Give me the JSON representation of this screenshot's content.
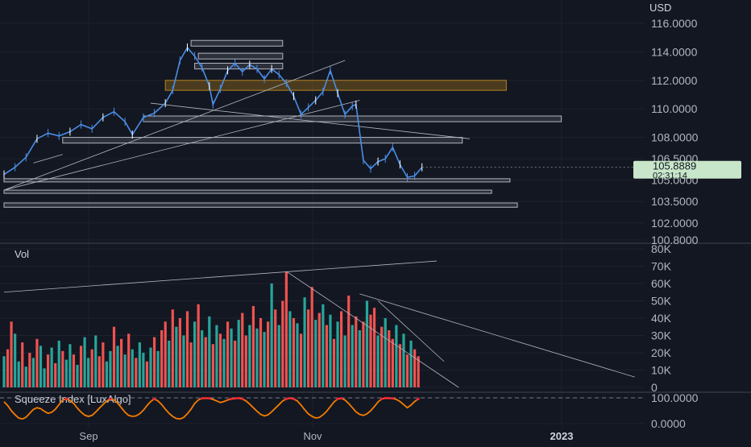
{
  "chart_data": [
    {
      "type": "candlestick",
      "name": "price",
      "currency": "USD",
      "y_ticks": [
        "116.0000",
        "114.0000",
        "112.0000",
        "110.0000",
        "108.0000",
        "106.5000",
        "105.0000",
        "103.5000",
        "102.0000",
        "100.8000"
      ],
      "last_price": "105.8889",
      "countdown": "02:31:14",
      "price_line": [
        {
          "t": 0,
          "v": 105.4
        },
        {
          "t": 3,
          "v": 105.9
        },
        {
          "t": 6,
          "v": 106.6
        },
        {
          "t": 9,
          "v": 107.9
        },
        {
          "t": 12,
          "v": 108.3
        },
        {
          "t": 15,
          "v": 108.1
        },
        {
          "t": 18,
          "v": 108.4
        },
        {
          "t": 21,
          "v": 108.9
        },
        {
          "t": 24,
          "v": 108.6
        },
        {
          "t": 27,
          "v": 109.4
        },
        {
          "t": 30,
          "v": 109.8
        },
        {
          "t": 33,
          "v": 109.1
        },
        {
          "t": 35,
          "v": 108.2
        },
        {
          "t": 38,
          "v": 109.4
        },
        {
          "t": 41,
          "v": 109.7
        },
        {
          "t": 44,
          "v": 110.4
        },
        {
          "t": 46,
          "v": 111.3
        },
        {
          "t": 48,
          "v": 113.4
        },
        {
          "t": 50,
          "v": 114.3
        },
        {
          "t": 52,
          "v": 113.7
        },
        {
          "t": 54,
          "v": 112.9
        },
        {
          "t": 56,
          "v": 111.6
        },
        {
          "t": 57,
          "v": 110.3
        },
        {
          "t": 59,
          "v": 111.4
        },
        {
          "t": 61,
          "v": 112.7
        },
        {
          "t": 63,
          "v": 113.2
        },
        {
          "t": 65,
          "v": 112.6
        },
        {
          "t": 67,
          "v": 113.1
        },
        {
          "t": 69,
          "v": 112.8
        },
        {
          "t": 71,
          "v": 112.1
        },
        {
          "t": 73,
          "v": 112.8
        },
        {
          "t": 75,
          "v": 112.4
        },
        {
          "t": 77,
          "v": 111.8
        },
        {
          "t": 79,
          "v": 110.9
        },
        {
          "t": 81,
          "v": 109.6
        },
        {
          "t": 83,
          "v": 110.1
        },
        {
          "t": 85,
          "v": 110.6
        },
        {
          "t": 87,
          "v": 111.2
        },
        {
          "t": 89,
          "v": 112.7
        },
        {
          "t": 91,
          "v": 111.1
        },
        {
          "t": 93,
          "v": 109.6
        },
        {
          "t": 95,
          "v": 110.2
        },
        {
          "t": 96,
          "v": 110.3
        },
        {
          "t": 98,
          "v": 106.4
        },
        {
          "t": 100,
          "v": 105.8
        },
        {
          "t": 102,
          "v": 106.3
        },
        {
          "t": 104,
          "v": 106.5
        },
        {
          "t": 106,
          "v": 107.3
        },
        {
          "t": 108,
          "v": 106.1
        },
        {
          "t": 110,
          "v": 105.2
        },
        {
          "t": 112,
          "v": 105.3
        },
        {
          "t": 114,
          "v": 105.9
        }
      ],
      "zones": [
        {
          "t1": 51,
          "t2": 76,
          "low": 114.4,
          "high": 114.8,
          "kind": "gray"
        },
        {
          "t1": 53,
          "t2": 76,
          "low": 113.5,
          "high": 113.9,
          "kind": "gray"
        },
        {
          "t1": 52,
          "t2": 76,
          "low": 112.8,
          "high": 113.2,
          "kind": "gray"
        },
        {
          "t1": 44,
          "t2": 137,
          "low": 111.3,
          "high": 112.0,
          "kind": "orange"
        },
        {
          "t1": 38,
          "t2": 152,
          "low": 109.1,
          "high": 109.5,
          "kind": "gray"
        },
        {
          "t1": 16,
          "t2": 125,
          "low": 107.6,
          "high": 108.0,
          "kind": "gray"
        },
        {
          "t1": 0,
          "t2": 138,
          "low": 104.9,
          "high": 105.1,
          "kind": "gray"
        },
        {
          "t1": 0,
          "t2": 133,
          "low": 104.1,
          "high": 104.3,
          "kind": "gray"
        },
        {
          "t1": 0,
          "t2": 140,
          "low": 103.1,
          "high": 103.4,
          "kind": "gray"
        }
      ],
      "trendlines": [
        {
          "t1": 0,
          "v1": 104.3,
          "t2": 93,
          "v2": 113.4
        },
        {
          "t1": 0,
          "v1": 104.3,
          "t2": 97,
          "v2": 110.6
        },
        {
          "t1": 40,
          "v1": 110.4,
          "t2": 127,
          "v2": 107.9
        },
        {
          "t1": 8,
          "v1": 106.2,
          "t2": 16,
          "v2": 106.8
        }
      ]
    },
    {
      "type": "bar",
      "name": "volume",
      "label": "Vol",
      "y_ticks": [
        "80K",
        "70K",
        "60K",
        "50K",
        "40K",
        "30K",
        "20K",
        "10K",
        "0"
      ],
      "ylim": [
        0,
        80000
      ],
      "values": [
        18000,
        22000,
        38000,
        31000,
        15000,
        26000,
        12000,
        20000,
        17000,
        28000,
        24000,
        11000,
        19000,
        23000,
        14000,
        27000,
        21000,
        16000,
        25000,
        19000,
        13000,
        24000,
        29000,
        17000,
        22000,
        30000,
        18000,
        26000,
        15000,
        21000,
        35000,
        24000,
        28000,
        19000,
        31000,
        22000,
        17000,
        26000,
        20000,
        15000,
        23000,
        29000,
        21000,
        33000,
        38000,
        27000,
        45000,
        35000,
        40000,
        30000,
        44000,
        26000,
        38000,
        48000,
        33000,
        29000,
        41000,
        25000,
        36000,
        31000,
        28000,
        38000,
        34000,
        27000,
        39000,
        43000,
        30000,
        36000,
        47000,
        34000,
        40000,
        32000,
        38000,
        60000,
        45000,
        36000,
        50000,
        67000,
        44000,
        40000,
        37000,
        31000,
        52000,
        45000,
        58000,
        39000,
        43000,
        48000,
        36000,
        42000,
        28000,
        38000,
        44000,
        30000,
        53000,
        36000,
        41000,
        33000,
        38000,
        50000,
        42000,
        46000,
        30000,
        35000,
        40000,
        33000,
        28000,
        36000,
        25000,
        31000,
        19000,
        27000,
        22000,
        18000
      ],
      "bar_colors": [
        "g",
        "r",
        "r",
        "g",
        "g",
        "r",
        "g",
        "r",
        "g",
        "r",
        "g",
        "g",
        "r",
        "g",
        "r",
        "g",
        "r",
        "g",
        "g",
        "r",
        "g",
        "r",
        "g",
        "g",
        "r",
        "g",
        "r",
        "r",
        "g",
        "g",
        "r",
        "g",
        "r",
        "g",
        "r",
        "g",
        "r",
        "g",
        "g",
        "r",
        "g",
        "r",
        "g",
        "r",
        "r",
        "g",
        "r",
        "g",
        "r",
        "g",
        "r",
        "r",
        "g",
        "r",
        "g",
        "r",
        "g",
        "r",
        "g",
        "r",
        "g",
        "r",
        "g",
        "r",
        "g",
        "r",
        "r",
        "g",
        "r",
        "g",
        "r",
        "g",
        "r",
        "g",
        "r",
        "g",
        "r",
        "r",
        "g",
        "r",
        "g",
        "r",
        "g",
        "r",
        "r",
        "g",
        "r",
        "g",
        "r",
        "g",
        "r",
        "g",
        "r",
        "g",
        "r",
        "g",
        "r",
        "g",
        "r",
        "g",
        "r",
        "r",
        "g",
        "r",
        "g",
        "r",
        "r",
        "g",
        "r",
        "g",
        "r",
        "g",
        "r",
        "r"
      ],
      "trendlines": [
        {
          "t1": 0,
          "v1": 55000,
          "t2": 118,
          "v2": 73000
        },
        {
          "t1": 77,
          "v1": 67000,
          "t2": 124,
          "v2": 0
        },
        {
          "t1": 97,
          "v1": 54000,
          "t2": 172,
          "v2": 6000
        },
        {
          "t1": 102,
          "v1": 50000,
          "t2": 120,
          "v2": 15000
        }
      ]
    },
    {
      "type": "line",
      "name": "oscillator",
      "label": "Squeeze Index [LuxAlgo]",
      "y_ticks": [
        "100.0000",
        "0.0000"
      ],
      "ylim": [
        0,
        100
      ],
      "values": [
        85,
        70,
        50,
        35,
        22,
        18,
        25,
        40,
        55,
        62,
        58,
        48,
        40,
        44,
        56,
        74,
        92,
        96,
        90,
        78,
        60,
        45,
        33,
        28,
        32,
        45,
        60,
        74,
        88,
        96,
        92,
        80,
        62,
        44,
        32,
        28,
        30,
        38,
        52,
        70,
        86,
        96,
        88,
        74,
        56,
        40,
        28,
        20,
        18,
        24,
        38,
        56,
        78,
        92,
        98,
        99,
        98,
        94,
        88,
        82,
        86,
        92,
        96,
        98,
        99,
        96,
        88,
        76,
        62,
        48,
        36,
        30,
        34,
        46,
        60,
        74,
        88,
        96,
        99,
        96,
        88,
        72,
        54,
        38,
        28,
        22,
        24,
        34,
        48,
        66,
        84,
        96,
        98,
        92,
        78,
        62,
        46,
        36,
        32,
        38,
        50,
        66,
        84,
        96,
        99,
        99,
        98,
        94,
        86,
        74,
        62,
        72,
        86,
        96
      ]
    }
  ],
  "x_ticks": [
    "Sep",
    "Nov",
    "2023"
  ],
  "colors": {
    "bg": "#131722",
    "grid": "#1e222d",
    "text": "#b2b5be",
    "candle": "#4a8ee6",
    "bull": "#26a69a",
    "bear": "#ef5350",
    "osc": "#f57c00",
    "osc_red": "#ff1744",
    "zone_gray": "#787b86",
    "zone_orange": "#b4821e",
    "price_label": "#c8e6c9"
  }
}
